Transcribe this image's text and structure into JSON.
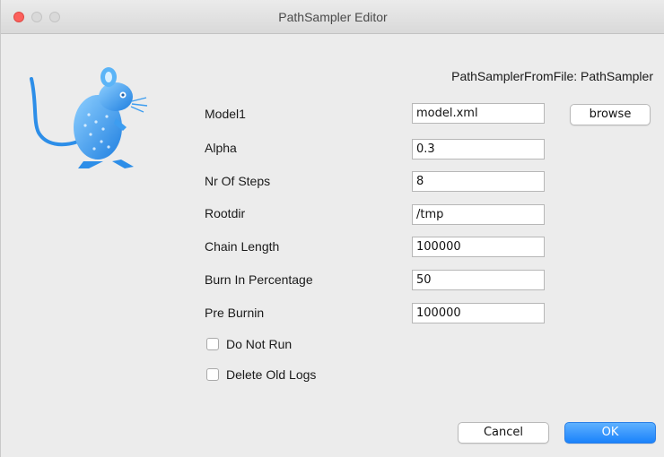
{
  "window": {
    "title": "PathSampler Editor"
  },
  "colors": {
    "accent": "#1a82fb",
    "close": "#fc605c",
    "mascot": "#3d9df0"
  },
  "heading": "PathSamplerFromFile: PathSampler",
  "fields": [
    {
      "label": "Model1",
      "value": "model.xml"
    },
    {
      "label": "Alpha",
      "value": "0.3"
    },
    {
      "label": "Nr Of Steps",
      "value": "8"
    },
    {
      "label": "Rootdir",
      "value": "/tmp"
    },
    {
      "label": "Chain Length",
      "value": "100000"
    },
    {
      "label": "Burn In Percentage",
      "value": "50"
    },
    {
      "label": "Pre Burnin",
      "value": "100000"
    }
  ],
  "browse_label": "browse",
  "checkboxes": [
    {
      "label": "Do Not Run",
      "checked": false
    },
    {
      "label": "Delete Old Logs",
      "checked": false
    }
  ],
  "buttons": {
    "cancel": "Cancel",
    "ok": "OK"
  },
  "icons": {
    "mascot": "mouse-mascot-icon"
  }
}
